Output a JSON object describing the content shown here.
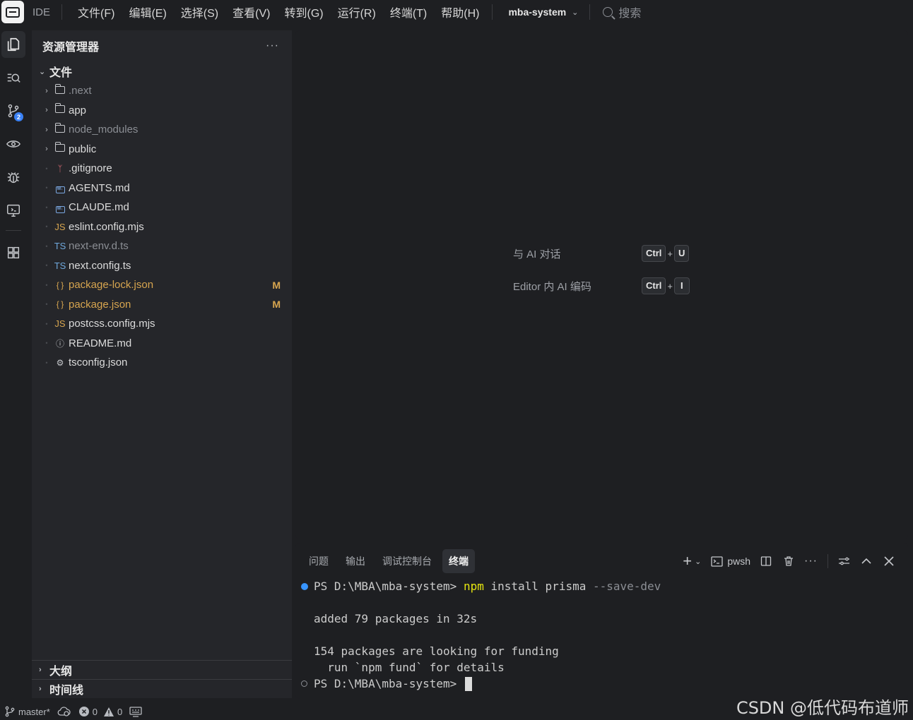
{
  "titlebar": {
    "app_label": "IDE",
    "menu": [
      "文件(F)",
      "编辑(E)",
      "选择(S)",
      "查看(V)",
      "转到(G)",
      "运行(R)",
      "终端(T)",
      "帮助(H)"
    ],
    "project": "mba-system",
    "search_placeholder": "搜索"
  },
  "activity": {
    "scm_badge": "2",
    "icons": [
      "explorer-icon",
      "search-icon",
      "source-control-icon",
      "preview-icon",
      "debug-icon",
      "remote-icon",
      "extensions-icon"
    ]
  },
  "sidebar": {
    "title": "资源管理器",
    "more": "···",
    "root_label": "文件",
    "items": [
      {
        "name": ".next",
        "type": "folder",
        "dim": true
      },
      {
        "name": "app",
        "type": "folder"
      },
      {
        "name": "node_modules",
        "type": "folder",
        "dim": true
      },
      {
        "name": "public",
        "type": "folder"
      },
      {
        "name": ".gitignore",
        "type": "git"
      },
      {
        "name": "AGENTS.md",
        "type": "md"
      },
      {
        "name": "CLAUDE.md",
        "type": "md"
      },
      {
        "name": "eslint.config.mjs",
        "type": "js"
      },
      {
        "name": "next-env.d.ts",
        "type": "ts",
        "dim": true
      },
      {
        "name": "next.config.ts",
        "type": "ts"
      },
      {
        "name": "package-lock.json",
        "type": "json",
        "git": "M"
      },
      {
        "name": "package.json",
        "type": "json",
        "git": "M"
      },
      {
        "name": "postcss.config.mjs",
        "type": "js"
      },
      {
        "name": "README.md",
        "type": "info"
      },
      {
        "name": "tsconfig.json",
        "type": "config"
      }
    ],
    "outline_label": "大纲",
    "timeline_label": "时间线"
  },
  "editor": {
    "hints": [
      {
        "label": "与 AI 对话",
        "keys": [
          "Ctrl",
          "U"
        ]
      },
      {
        "label": "Editor 内 AI 编码",
        "keys": [
          "Ctrl",
          "I"
        ]
      }
    ],
    "plus": "+"
  },
  "panel": {
    "tabs": [
      "问题",
      "输出",
      "调试控制台",
      "终端"
    ],
    "active_tab": 3,
    "shell": "pwsh",
    "terminal": {
      "prompt": "PS D:\\MBA\\mba-system>",
      "cmd": "npm",
      "args": "install prisma",
      "flag": "--save-dev",
      "out1": "added 79 packages in 32s",
      "out2": "154 packages are looking for funding",
      "out3": "  run `npm fund` for details"
    }
  },
  "status": {
    "branch": "master*",
    "errors": "0",
    "warnings": "0"
  },
  "watermark": "CSDN @低代码布道师"
}
